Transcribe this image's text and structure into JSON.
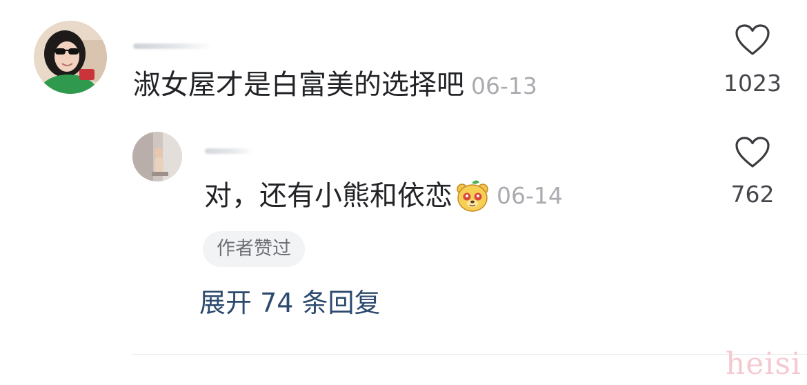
{
  "comment": {
    "text": "淑女屋才是白富美的选择吧",
    "date": "06-13",
    "like_count": "1023"
  },
  "reply": {
    "text": "对，还有小熊和依恋",
    "emoji": "bear-face-emoji",
    "date": "06-14",
    "like_count": "762",
    "author_badge": "作者赞过"
  },
  "expand": {
    "label": "展开 74 条回复"
  },
  "watermark": "heisi",
  "colors": {
    "text_primary": "#222326",
    "text_date": "#a9abb0",
    "link": "#2c4a6e",
    "badge_bg": "#f2f3f5"
  }
}
